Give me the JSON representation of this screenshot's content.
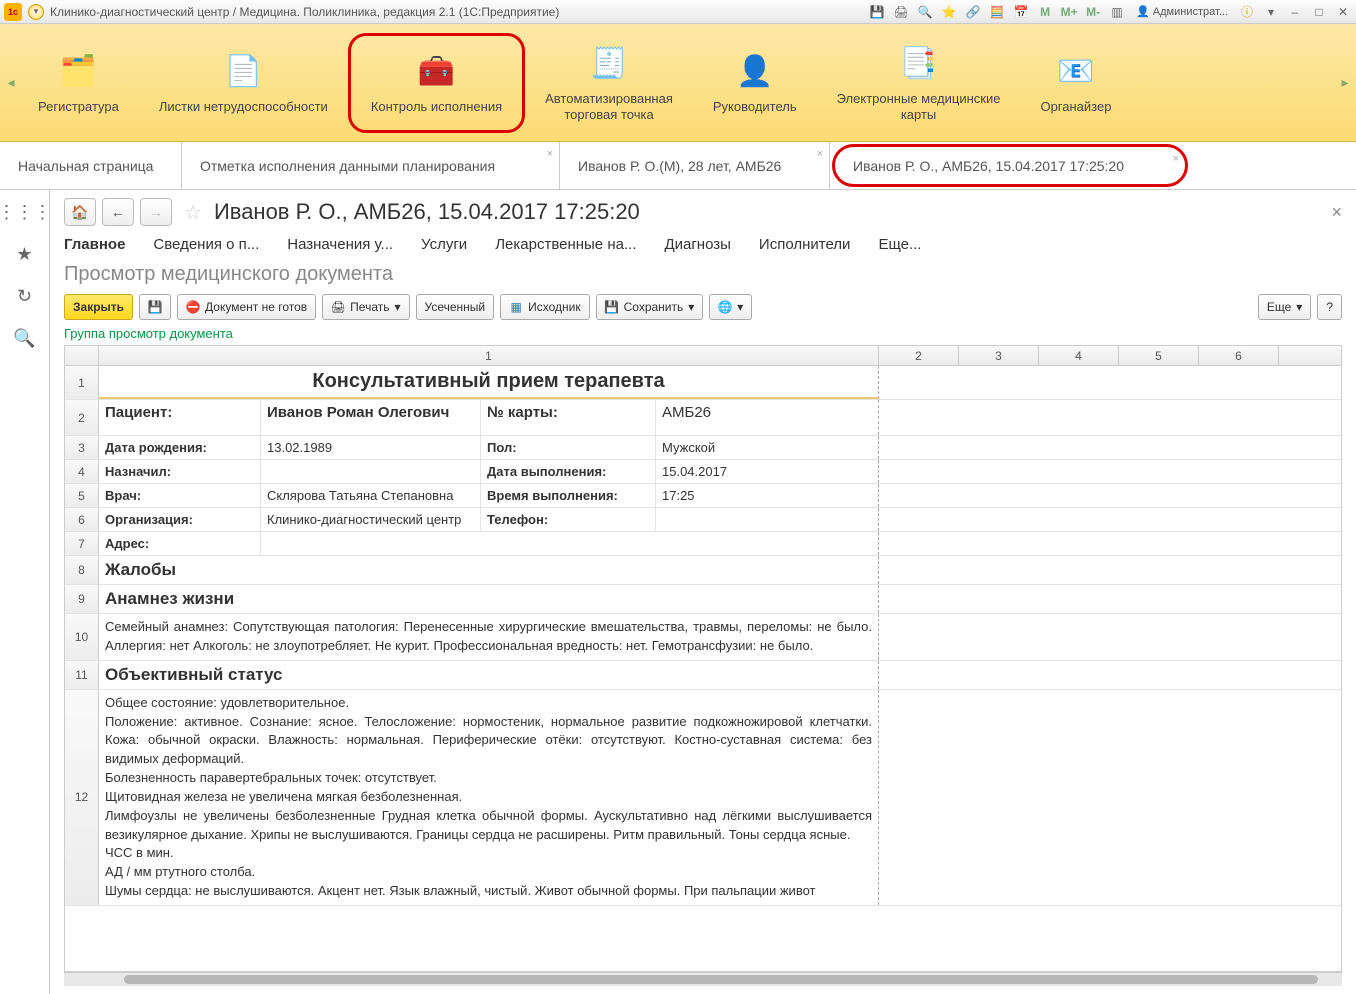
{
  "titlebar": {
    "title": "Клинико-диагностический центр / Медицина. Поликлиника, редакция 2.1  (1С:Предприятие)",
    "user": "Администрат..."
  },
  "sections": [
    {
      "label": "Регистратура"
    },
    {
      "label": "Листки нетрудоспособности"
    },
    {
      "label": "Контроль исполнения"
    },
    {
      "label": "Автоматизированная\nторговая точка"
    },
    {
      "label": "Руководитель"
    },
    {
      "label": "Электронные медицинские\nкарты"
    },
    {
      "label": "Органайзер"
    }
  ],
  "tabs": [
    {
      "label": "Начальная страница"
    },
    {
      "label": "Отметка исполнения данными планирования"
    },
    {
      "label": "Иванов Р. О.(М), 28 лет, АМБ26"
    },
    {
      "label": "Иванов Р. О., АМБ26, 15.04.2017 17:25:20"
    }
  ],
  "page": {
    "title": "Иванов Р. О., АМБ26, 15.04.2017 17:25:20",
    "subtabs": [
      "Главное",
      "Сведения о п...",
      "Назначения у...",
      "Услуги",
      "Лекарственные на...",
      "Диагнозы",
      "Исполнители",
      "Еще..."
    ],
    "subtitle": "Просмотр медицинского документа",
    "group_link": "Группа просмотр документа"
  },
  "toolbar": {
    "close": "Закрыть",
    "not_ready": "Документ не готов",
    "print": "Печать",
    "truncated": "Усеченный",
    "source": "Исходник",
    "save": "Сохранить",
    "more": "Еще"
  },
  "columns": [
    "",
    "1",
    "2",
    "3",
    "4",
    "5",
    "6"
  ],
  "doc": {
    "title": "Консультативный прием терапевта",
    "r2": {
      "a": "Пациент:",
      "b": "Иванов Роман Олегович",
      "c": "№ карты:",
      "d": "АМБ26"
    },
    "r3": {
      "a": "Дата рождения:",
      "b": "13.02.1989",
      "c": "Пол:",
      "d": "Мужской"
    },
    "r4": {
      "a": "Назначил:",
      "b": "",
      "c": "Дата выполнения:",
      "d": "15.04.2017"
    },
    "r5": {
      "a": "Врач:",
      "b": "Склярова Татьяна Степановна",
      "c": "Время выполнения:",
      "d": "17:25"
    },
    "r6": {
      "a": "Организация:",
      "b": "Клинико-диагностический центр",
      "c": "Телефон:",
      "d": ""
    },
    "r7": {
      "a": "Адрес:"
    },
    "r8": "Жалобы",
    "r9": "Анамнез жизни",
    "r10": "Семейный анамнез:  Сопутствующая патология:   Перенесенные хирургические вмешательства, травмы, переломы:  не было.  Аллергия: нет  Алкоголь: не злоупотребляет. Не курит. Профессиональная вредность: нет. Гемотрансфузии: не было.",
    "r11": "Объективный статус",
    "r12": "Общее состояние: удовлетворительное.\nПоложение: активное. Сознание: ясное. Телосложение: нормостеник, нормальное развитие подкожножировой клетчатки. Кожа: обычной окраски.  Влажность: нормальная. Периферические отёки: отсутствуют. Костно-суставная система: без видимых деформаций.\nБолезненность паравертебральных точек: отсутствует.\nЩитовидная железа не увеличена мягкая безболезненная.\nЛимфоузлы не увеличены безболезненные Грудная клетка   обычной формы. Аускультативно над лёгкими выслушивается  везикулярное дыхание. Хрипы не выслушиваются. Границы сердца не расширены.  Ритм правильный.  Тоны сердца ясные.\nЧСС  в мин.\nАД  /   мм ртутного столба.\nШумы сердца:   не выслушиваются. Акцент нет. Язык влажный, чистый. Живот обычной формы. При пальпации живот"
  }
}
